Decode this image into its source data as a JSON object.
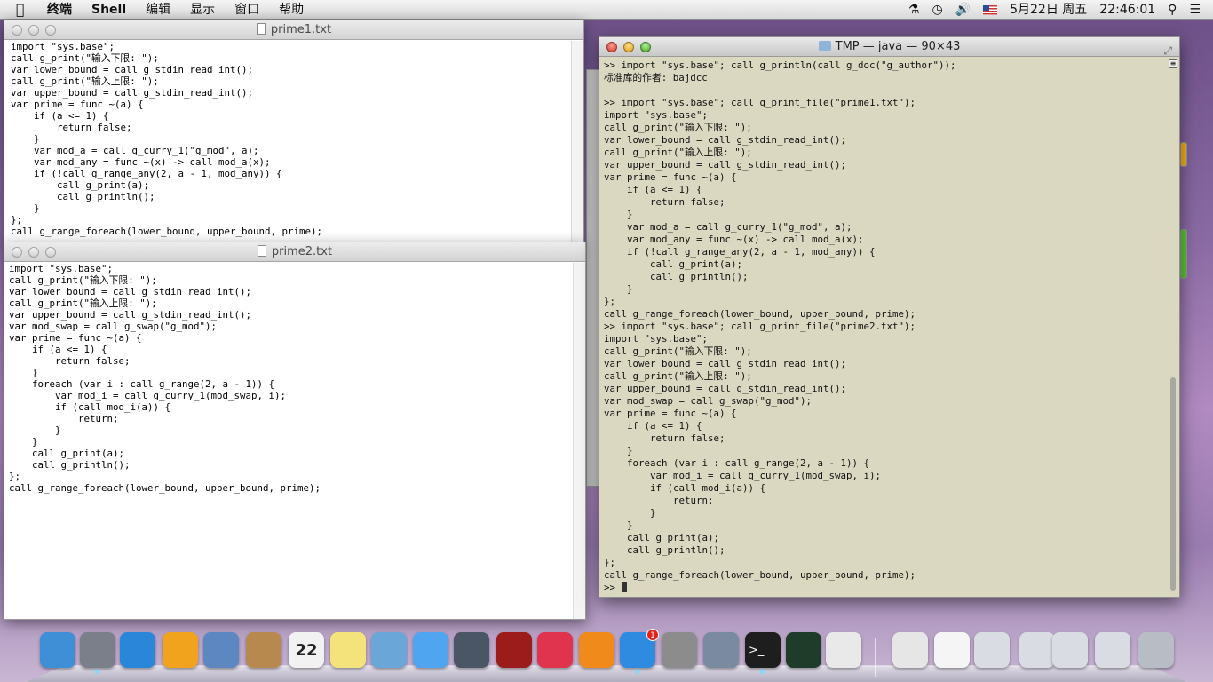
{
  "menubar": {
    "apple": "",
    "items": [
      "终端",
      "Shell",
      "编辑",
      "显示",
      "窗口",
      "帮助"
    ],
    "date": "5月22日 周五",
    "time": "22:46:01"
  },
  "prime1": {
    "title": "prime1.txt",
    "lines": [
      "import \"sys.base\";",
      "call g_print(\"输入下限: \");",
      "var lower_bound = call g_stdin_read_int();",
      "call g_print(\"输入上限: \");",
      "var upper_bound = call g_stdin_read_int();",
      "var prime = func ~(a) {",
      "    if (a <= 1) {",
      "        return false;",
      "    }",
      "    var mod_a = call g_curry_1(\"g_mod\", a);",
      "    var mod_any = func ~(x) -> call mod_a(x);",
      "    if (!call g_range_any(2, a - 1, mod_any)) {",
      "        call g_print(a);",
      "        call g_println();",
      "    }",
      "};",
      "call g_range_foreach(lower_bound, upper_bound, prime);"
    ]
  },
  "prime2": {
    "title": "prime2.txt",
    "lines": [
      "import \"sys.base\";",
      "call g_print(\"输入下限: \");",
      "var lower_bound = call g_stdin_read_int();",
      "call g_print(\"输入上限: \");",
      "var upper_bound = call g_stdin_read_int();",
      "var mod_swap = call g_swap(\"g_mod\");",
      "var prime = func ~(a) {",
      "    if (a <= 1) {",
      "        return false;",
      "    }",
      "    foreach (var i : call g_range(2, a - 1)) {",
      "        var mod_i = call g_curry_1(mod_swap, i);",
      "        if (call mod_i(a)) {",
      "            return;",
      "        }",
      "    }",
      "    call g_print(a);",
      "    call g_println();",
      "};",
      "call g_range_foreach(lower_bound, upper_bound, prime);"
    ]
  },
  "terminal": {
    "title": "TMP — java — 90×43",
    "lines": [
      ">> import \"sys.base\"; call g_println(call g_doc(\"g_author\"));",
      "标准库的作者: bajdcc",
      "",
      ">> import \"sys.base\"; call g_print_file(\"prime1.txt\");",
      "import \"sys.base\";",
      "call g_print(\"输入下限: \");",
      "var lower_bound = call g_stdin_read_int();",
      "call g_print(\"输入上限: \");",
      "var upper_bound = call g_stdin_read_int();",
      "var prime = func ~(a) {",
      "    if (a <= 1) {",
      "        return false;",
      "    }",
      "    var mod_a = call g_curry_1(\"g_mod\", a);",
      "    var mod_any = func ~(x) -> call mod_a(x);",
      "    if (!call g_range_any(2, a - 1, mod_any)) {",
      "        call g_print(a);",
      "        call g_println();",
      "    }",
      "};",
      "call g_range_foreach(lower_bound, upper_bound, prime);",
      ">> import \"sys.base\"; call g_print_file(\"prime2.txt\");",
      "import \"sys.base\";",
      "call g_print(\"输入下限: \");",
      "var lower_bound = call g_stdin_read_int();",
      "call g_print(\"输入上限: \");",
      "var upper_bound = call g_stdin_read_int();",
      "var mod_swap = call g_swap(\"g_mod\");",
      "var prime = func ~(a) {",
      "    if (a <= 1) {",
      "        return false;",
      "    }",
      "    foreach (var i : call g_range(2, a - 1)) {",
      "        var mod_i = call g_curry_1(mod_swap, i);",
      "        if (call mod_i(a)) {",
      "            return;",
      "        }",
      "    }",
      "    call g_print(a);",
      "    call g_println();",
      "};",
      "call g_range_foreach(lower_bound, upper_bound, prime);"
    ],
    "prompt": ">> "
  },
  "dock": {
    "calendar_day": "22",
    "appstore_badge": "1",
    "icons": [
      {
        "name": "finder-icon",
        "color": "#3f8fd6"
      },
      {
        "name": "launchpad-icon",
        "color": "#7a7f8a"
      },
      {
        "name": "safari-icon",
        "color": "#2a86d9"
      },
      {
        "name": "cloud-icon",
        "color": "#f2a31d"
      },
      {
        "name": "mail-icon",
        "color": "#5c87c0"
      },
      {
        "name": "contacts-icon",
        "color": "#b8894e"
      },
      {
        "name": "calendar-icon",
        "color": "#f2f2f2"
      },
      {
        "name": "notes-icon",
        "color": "#f4e27a"
      },
      {
        "name": "preview-icon",
        "color": "#6aa6d8"
      },
      {
        "name": "messages-icon",
        "color": "#4fa5f0"
      },
      {
        "name": "facetime-icon",
        "color": "#4a5565"
      },
      {
        "name": "photobooth-icon",
        "color": "#9c1b1b"
      },
      {
        "name": "itunes-icon",
        "color": "#e0334d"
      },
      {
        "name": "ibooks-icon",
        "color": "#f08a1a"
      },
      {
        "name": "appstore-icon",
        "color": "#2f8be0"
      },
      {
        "name": "system-preferences-icon",
        "color": "#8c8c8c"
      },
      {
        "name": "iphoto-icon",
        "color": "#7a8aa0"
      },
      {
        "name": "terminal-icon",
        "color": "#1e1e1e"
      },
      {
        "name": "activity-monitor-icon",
        "color": "#1f3b2a"
      },
      {
        "name": "textedit-icon",
        "color": "#e9e9e9"
      },
      {
        "name": "zip-file-icon",
        "color": "#e6e6e6"
      },
      {
        "name": "document-icon",
        "color": "#f5f5f5"
      },
      {
        "name": "screenshot-stack-icon",
        "color": "#d9dde3"
      },
      {
        "name": "downloads-stack-icon",
        "color": "#d9dde3"
      },
      {
        "name": "window-stack-icon",
        "color": "#d9dde3"
      },
      {
        "name": "screen-stack-icon",
        "color": "#d9dde3"
      },
      {
        "name": "trash-icon",
        "color": "#b8bcc4"
      }
    ]
  }
}
